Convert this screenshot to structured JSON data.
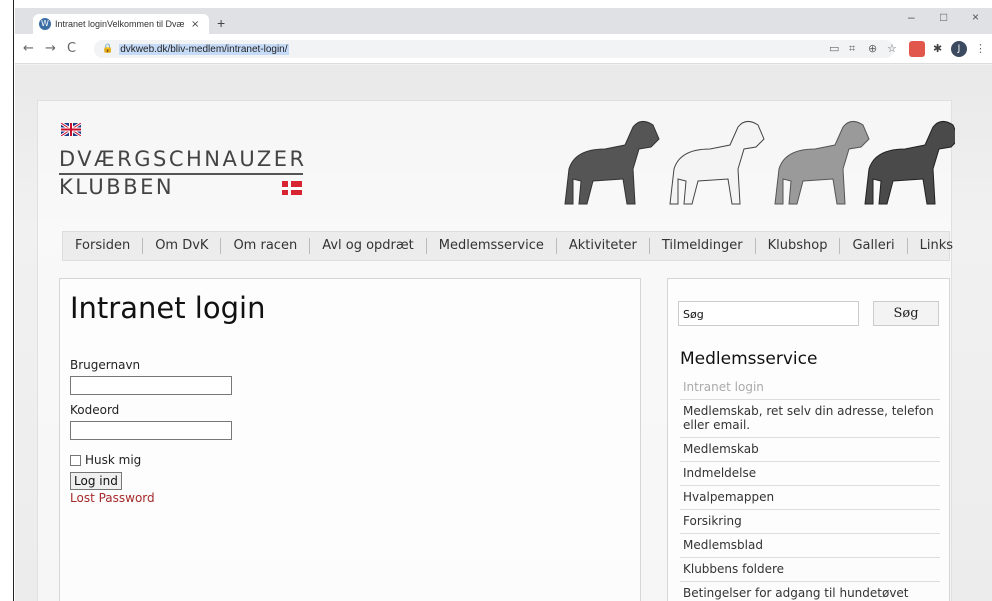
{
  "browser": {
    "tab_title": "Intranet loginVelkommen til Dvæ",
    "tab_close": "×",
    "new_tab": "+",
    "url": "dvkweb.dk/bliv-medlem/intranet-login/",
    "profile_initial": "J",
    "win_min": "–",
    "win_max": "□",
    "win_close": "×"
  },
  "header": {
    "logo_line1": "DVÆRGSCHNAUZER",
    "logo_line2": "KLUBBEN"
  },
  "nav": {
    "items": [
      "Forsiden",
      "Om DvK",
      "Om racen",
      "Avl og opdræt",
      "Medlemsservice",
      "Aktiviteter",
      "Tilmeldinger",
      "Klubshop",
      "Galleri",
      "Links"
    ]
  },
  "login": {
    "heading": "Intranet login",
    "username_label": "Brugernavn",
    "password_label": "Kodeord",
    "remember_label": "Husk mig",
    "submit_label": "Log ind",
    "lost_password": "Lost Password"
  },
  "sidebar": {
    "search_value": "Søg",
    "search_button": "Søg",
    "title": "Medlemsservice",
    "items": [
      {
        "label": "Intranet login",
        "active": true
      },
      {
        "label": "Medlemskab, ret selv din adresse, telefon eller email.",
        "active": false
      },
      {
        "label": "Medlemskab",
        "active": false
      },
      {
        "label": "Indmeldelse",
        "active": false
      },
      {
        "label": "Hvalpemappen",
        "active": false
      },
      {
        "label": "Forsikring",
        "active": false
      },
      {
        "label": "Medlemsblad",
        "active": false
      },
      {
        "label": "Klubbens foldere",
        "active": false
      },
      {
        "label": "Betingelser for adgang til hundetøvet",
        "active": false
      }
    ]
  },
  "colors": {
    "link": "#a52a2a",
    "flag_dk": "#d72631"
  }
}
